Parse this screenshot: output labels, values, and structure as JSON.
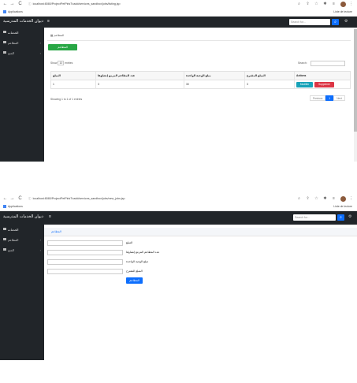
{
  "screen1": {
    "browser": {
      "back": "←",
      "forward": "→",
      "reload": "C",
      "url": "localhost:8080/ProjectPetPinkTvadd/services_sandbox/jobs/listing.jsp",
      "bookmark": "Applications",
      "reading_list": "Liste de lecture"
    },
    "app": {
      "brand": "ديوان الخدمات المدرسية",
      "search_placeholder": "Search for...",
      "sidebar": [
        {
          "label": "الخدمات",
          "icon": "dashboard-icon"
        },
        {
          "label": "المطاعم",
          "icon": "table-icon"
        },
        {
          "label": "المنح",
          "icon": "table-icon"
        }
      ],
      "breadcrumb": "المطاعم",
      "add_button": "المطاعم",
      "show_label": "Show",
      "show_value": "10",
      "entries_label": "entries",
      "search_label": "Search:",
      "columns": [
        "Actions",
        "المبلغ المقترح",
        "مبلغ الوجبة الواحدة",
        "عدد المطاعم المزمع إنشاؤها",
        "المبلغ"
      ],
      "rows": [
        {
          "cells": [
            "3",
            "30",
            "3",
            "1"
          ]
        }
      ],
      "modifier": "Modifier",
      "supprimer": "Supprimer",
      "info_text": "Showing 1 to 1 of 1 entries",
      "pager": {
        "previous": "Previous",
        "page": "1",
        "next": "Next"
      }
    }
  },
  "screen2": {
    "browser": {
      "back": "←",
      "forward": "→",
      "reload": "C",
      "url": "localhost:8080/ProjectPetPinkTvadd/services_sandbox/jobs/new_jobs.jsp",
      "bookmark": "Applications",
      "reading_list": "Liste de lecture"
    },
    "app": {
      "brand": "ديوان الخدمات المدرسية",
      "search_placeholder": "Search for...",
      "sidebar": [
        {
          "label": "الخدمات",
          "icon": "dashboard-icon"
        },
        {
          "label": "المطاعم",
          "icon": "table-icon"
        },
        {
          "label": "المنح",
          "icon": "table-icon"
        }
      ],
      "breadcrumb": "المطاعم",
      "form": {
        "fields": [
          {
            "label": "المبلغ",
            "value": ""
          },
          {
            "label": "عدد المطاعم المزمع إنشاؤها",
            "value": ""
          },
          {
            "label": "مبلغ الوجبة الواحدة",
            "value": ""
          },
          {
            "label": "المبلغ المقترح",
            "value": ""
          }
        ],
        "submit": "المطاعم"
      }
    }
  },
  "colors": {
    "navbar": "#212529",
    "success": "#28a745",
    "primary": "#0d6efd",
    "info": "#17a2b8",
    "danger": "#dc3545"
  }
}
